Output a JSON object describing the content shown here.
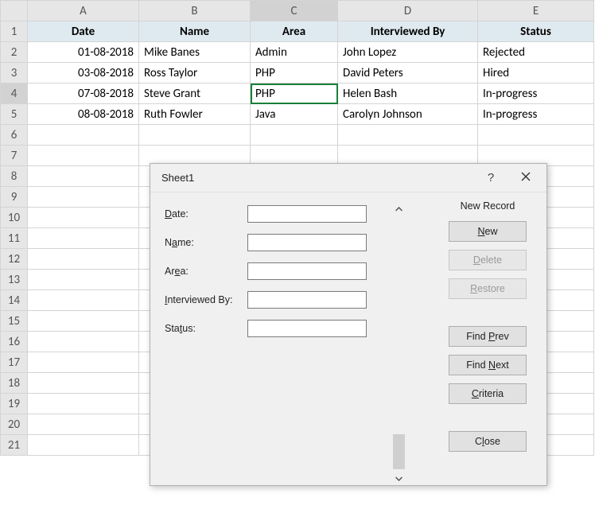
{
  "columns": {
    "hdr_corner": "",
    "A": "A",
    "B": "B",
    "C": "C",
    "D": "D",
    "E": "E"
  },
  "rownums": [
    "1",
    "2",
    "3",
    "4",
    "5",
    "6",
    "7",
    "8",
    "9",
    "10",
    "11",
    "12",
    "13",
    "14",
    "15",
    "16",
    "17",
    "18",
    "19",
    "20",
    "21"
  ],
  "headers": {
    "date": "Date",
    "name": "Name",
    "area": "Area",
    "interviewed_by": "Interviewed By",
    "status": "Status"
  },
  "rows": [
    {
      "date": "01-08-2018",
      "name": "Mike Banes",
      "area": "Admin",
      "interviewer": "John Lopez",
      "status": "Rejected"
    },
    {
      "date": "03-08-2018",
      "name": "Ross Taylor",
      "area": "PHP",
      "interviewer": "David Peters",
      "status": "Hired"
    },
    {
      "date": "07-08-2018",
      "name": "Steve Grant",
      "area": "PHP",
      "interviewer": "Helen Bash",
      "status": "In-progress"
    },
    {
      "date": "08-08-2018",
      "name": "Ruth Fowler",
      "area": "Java",
      "interviewer": "Carolyn Johnson",
      "status": "In-progress"
    }
  ],
  "dialog": {
    "title": "Sheet1",
    "status": "New Record",
    "fields": {
      "date": "Date:",
      "name": "Name:",
      "area": "Area:",
      "interviewed_by": "Interviewed By:",
      "status": "Status:"
    },
    "values": {
      "date": "",
      "name": "",
      "area": "",
      "interviewed_by": "",
      "status": ""
    },
    "buttons": {
      "new": "New",
      "delete": "Delete",
      "restore": "Restore",
      "find_prev": "Find Prev",
      "find_next": "Find Next",
      "criteria": "Criteria",
      "close": "Close"
    },
    "underline": {
      "new": "N",
      "delete": "D",
      "restore": "R",
      "find_prev": "P",
      "find_next": "N",
      "criteria": "C",
      "close": "l",
      "date": "D",
      "name": "a",
      "area": "e",
      "interviewed_by": "I",
      "status": "t"
    }
  },
  "chart_data": {
    "type": "table",
    "columns": [
      "Date",
      "Name",
      "Area",
      "Interviewed By",
      "Status"
    ],
    "rows": [
      [
        "01-08-2018",
        "Mike Banes",
        "Admin",
        "John Lopez",
        "Rejected"
      ],
      [
        "03-08-2018",
        "Ross Taylor",
        "PHP",
        "David Peters",
        "Hired"
      ],
      [
        "07-08-2018",
        "Steve Grant",
        "PHP",
        "Helen Bash",
        "In-progress"
      ],
      [
        "08-08-2018",
        "Ruth Fowler",
        "Java",
        "Carolyn Johnson",
        "In-progress"
      ]
    ],
    "title": "Sheet1"
  }
}
